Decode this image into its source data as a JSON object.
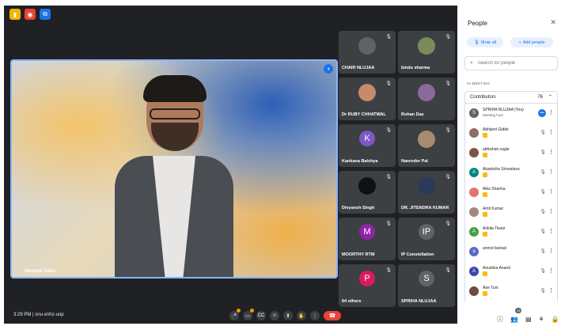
{
  "top_icons": [
    {
      "name": "notes-icon",
      "color": "#f4b400",
      "glyph": "▮"
    },
    {
      "name": "record-icon",
      "color": "#ea4335",
      "glyph": "◉"
    },
    {
      "name": "share-doc-icon",
      "color": "#1a73e8",
      "glyph": "⧉"
    }
  ],
  "main_speaker": {
    "name": "Swapnil Saha"
  },
  "tiles": [
    {
      "label": "CHAIR NLUJAA",
      "avatar": "",
      "color": "#5f6368",
      "photo": true
    },
    {
      "label": "bindu sharma",
      "avatar": "",
      "color": "#7a8b5a",
      "photo": true
    },
    {
      "label": "Dr RUBY CHHATWAL",
      "avatar": "",
      "color": "#c98a6b",
      "photo": true
    },
    {
      "label": "Rohan Das",
      "avatar": "",
      "color": "#8a6a9a",
      "photo": true
    },
    {
      "label": "Kankana Baishya",
      "avatar": "K",
      "color": "#7e57c2",
      "photo": false
    },
    {
      "label": "Narender Pal",
      "avatar": "",
      "color": "#a88a70",
      "photo": true
    },
    {
      "label": "Divyansh Singh",
      "avatar": "",
      "color": "#111111",
      "photo": true
    },
    {
      "label": "DR. JITENDRA KUMAR",
      "avatar": "",
      "color": "#2b3a5a",
      "photo": true
    },
    {
      "label": "MOORTHY RTM",
      "avatar": "M",
      "color": "#8e24aa",
      "photo": false
    },
    {
      "label": "IP Constellation",
      "avatar": "IP",
      "color": "#5f6368",
      "photo": false
    },
    {
      "label": "64 others",
      "avatar": "P",
      "color": "#d81b60",
      "photo": false
    },
    {
      "label": "SPRIHA NLUJAA",
      "avatar": "S",
      "color": "#5f6368",
      "photo": false
    }
  ],
  "bottom": {
    "time": "3:29 PM",
    "separator": "|",
    "code": "snu-xnhz-uop",
    "participant_badge": "76"
  },
  "people_panel": {
    "title": "People",
    "mute_all": "Mute all",
    "add_people": "Add people",
    "search_placeholder": "Search for people",
    "in_meeting": "IN MEETING",
    "contributors_label": "Contributors",
    "contributors_count": "76",
    "people": [
      {
        "name": "SPRIHA NLUJAA (You)",
        "sub": "Meeting host",
        "avatar": "S",
        "color": "#5f6368",
        "hand": false,
        "host": true
      },
      {
        "name": "Abhijeet Gidde",
        "sub": "",
        "avatar": "",
        "color": "#8d6e63",
        "hand": true,
        "host": false
      },
      {
        "name": "abhishek nagle",
        "sub": "",
        "avatar": "",
        "color": "#795548",
        "hand": true,
        "host": false
      },
      {
        "name": "Akanksha Srivastava",
        "sub": "",
        "avatar": "A",
        "color": "#00897b",
        "hand": true,
        "host": false
      },
      {
        "name": "Alka Sharma",
        "sub": "",
        "avatar": "",
        "color": "#e57373",
        "hand": true,
        "host": false
      },
      {
        "name": "Amit Kumar",
        "sub": "",
        "avatar": "",
        "color": "#a1887f",
        "hand": true,
        "host": false
      },
      {
        "name": "Ankita Tiwari",
        "sub": "",
        "avatar": "A",
        "color": "#43a047",
        "hand": true,
        "host": false
      },
      {
        "name": "anmol bansal",
        "sub": "",
        "avatar": "a",
        "color": "#5c6bc0",
        "hand": false,
        "host": false
      },
      {
        "name": "Anushka Anand",
        "sub": "",
        "avatar": "A",
        "color": "#3949ab",
        "hand": true,
        "host": false
      },
      {
        "name": "Ase Tuni",
        "sub": "",
        "avatar": "",
        "color": "#6d4c41",
        "hand": true,
        "host": false
      }
    ]
  }
}
